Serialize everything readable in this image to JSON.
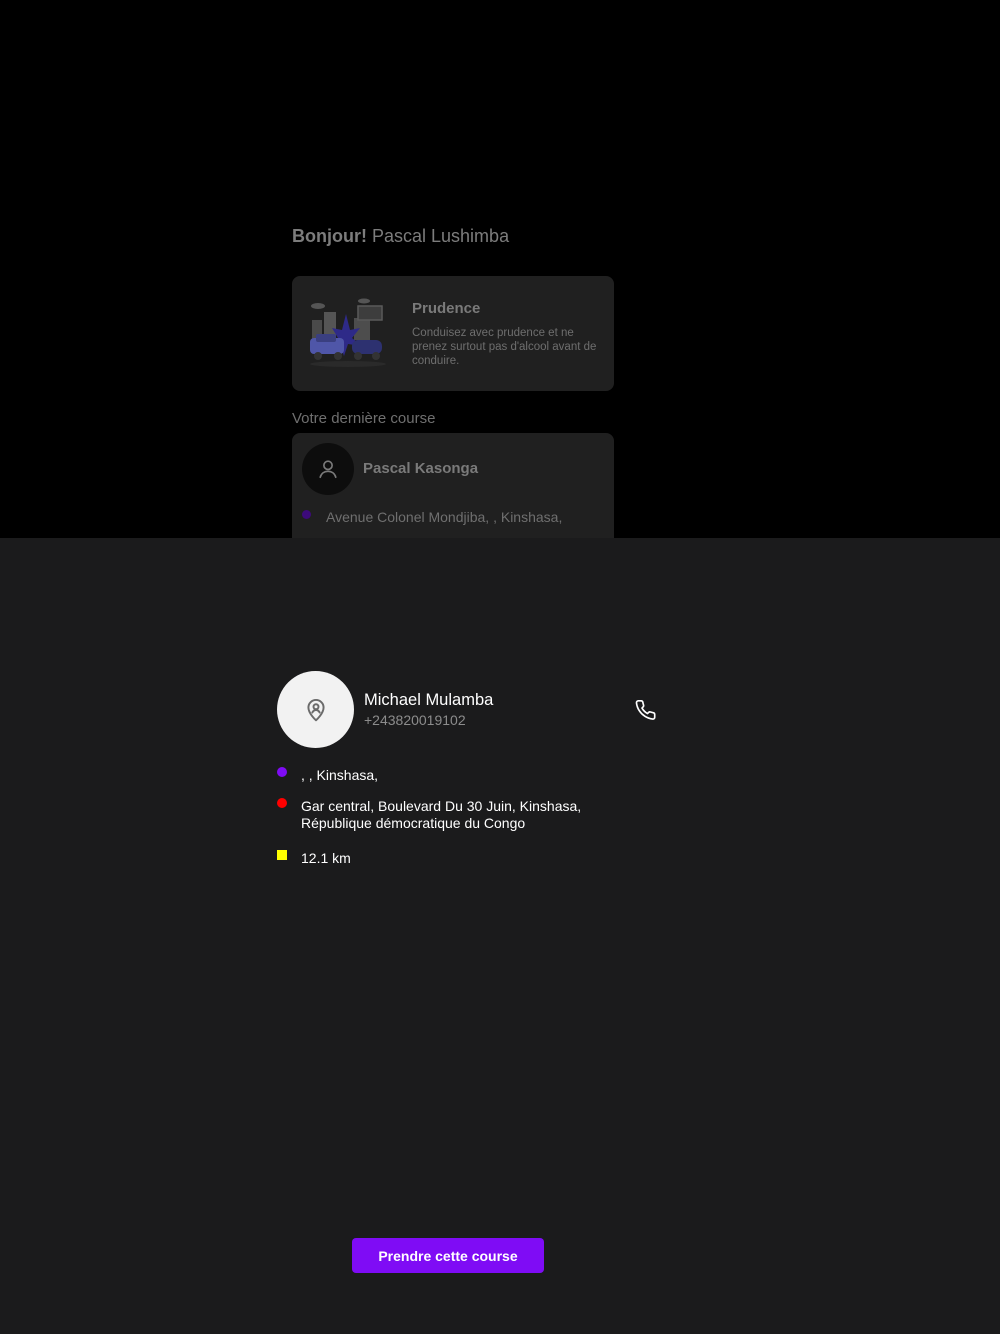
{
  "background_page": {
    "greeting_bold": "Bonjour!",
    "greeting_name": "Pascal Lushimba",
    "tip_card": {
      "title": "Prudence",
      "text": "Conduisez avec prudence et ne prenez surtout pas d'alcool avant de conduire."
    },
    "last_ride_label": "Votre dernière course",
    "last_ride": {
      "driver_name": "Pascal Kasonga",
      "address": "Avenue Colonel Mondjiba, , Kinshasa,"
    }
  },
  "sheet": {
    "client": {
      "name": "Michael Mulamba",
      "phone": "+243820019102",
      "avatar_icon": "location-person-icon",
      "call_icon": "phone-icon"
    },
    "route": {
      "pickup": ", , Kinshasa,",
      "destination_line1": "Gar central, Boulevard Du 30 Juin, Kinshasa,",
      "destination_line2": "République démocratique du Congo",
      "distance": "12.1 km"
    },
    "take_button_label": "Prendre cette course"
  },
  "colors": {
    "accent": "#7f0cf5",
    "pickup_marker": "#7f0cf5",
    "destination_marker": "#ff0000",
    "distance_marker": "#ffff00",
    "sheet_background": "#1b1b1c"
  }
}
